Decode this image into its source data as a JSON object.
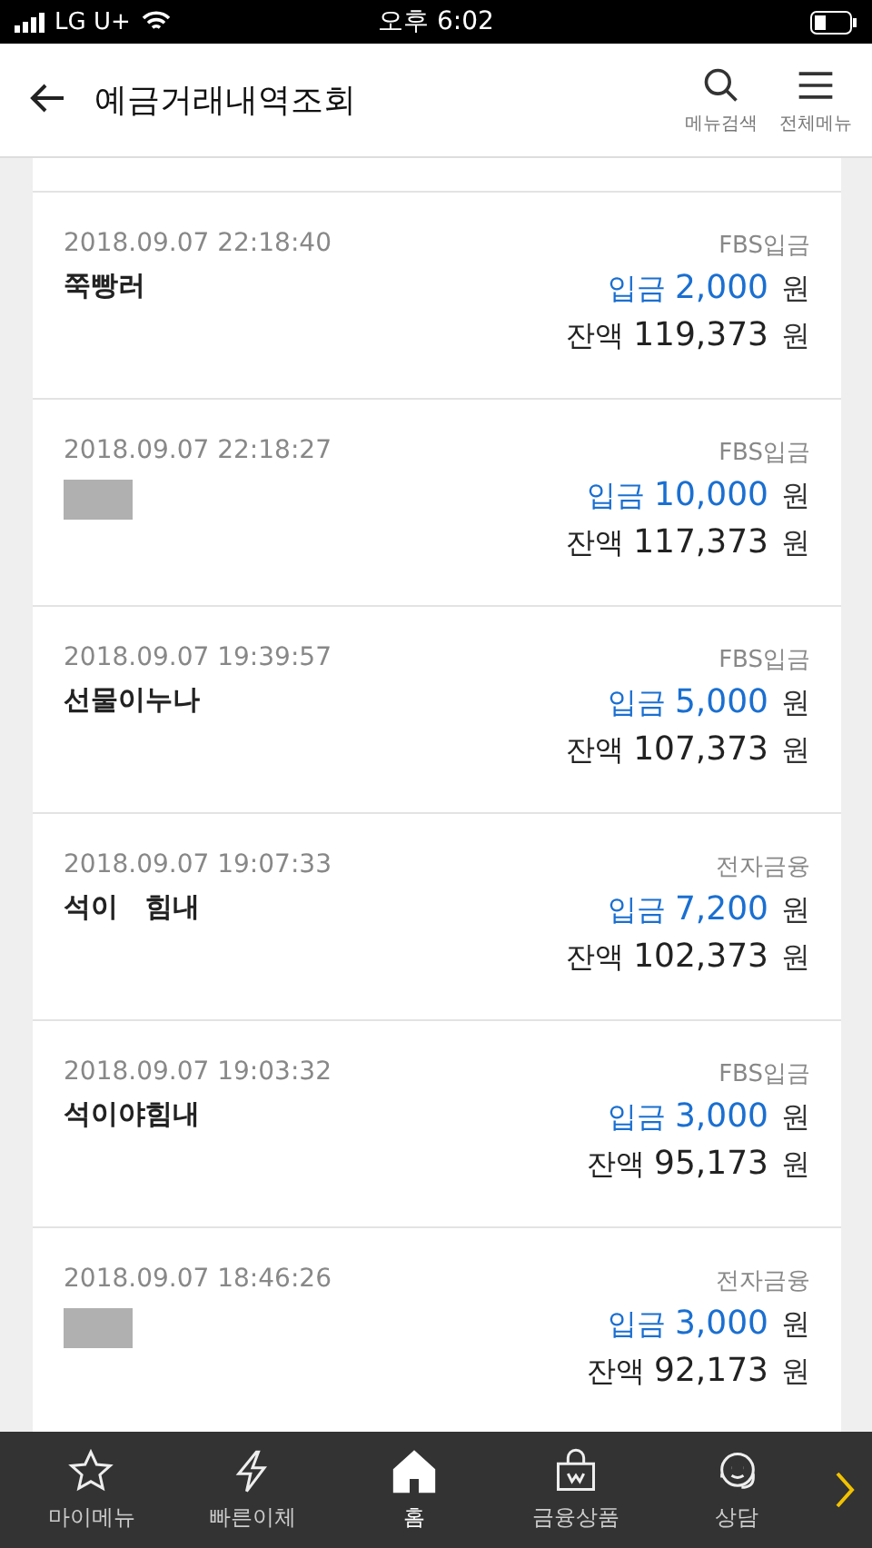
{
  "status_bar": {
    "carrier": "LG U+",
    "time": "오후 6:02"
  },
  "header": {
    "title": "예금거래내역조회",
    "actions": [
      {
        "kind": "search",
        "label": "메뉴검색"
      },
      {
        "kind": "menu",
        "label": "전체메뉴"
      }
    ]
  },
  "transactions": [
    {
      "datetime": "2018.09.07 22:18:40",
      "name": "쭉빵러",
      "redacted": false,
      "type": "FBS입금",
      "amount_label": "입금",
      "amount": "2,000",
      "amount_unit": "원",
      "balance_label": "잔액",
      "balance": "119,373",
      "balance_unit": "원"
    },
    {
      "datetime": "2018.09.07 22:18:27",
      "redacted": true,
      "type": "FBS입금",
      "amount_label": "입금",
      "amount": "10,000",
      "amount_unit": "원",
      "balance_label": "잔액",
      "balance": "117,373",
      "balance_unit": "원"
    },
    {
      "datetime": "2018.09.07 19:39:57",
      "name": "선물이누나",
      "redacted": false,
      "type": "FBS입금",
      "amount_label": "입금",
      "amount": "5,000",
      "amount_unit": "원",
      "balance_label": "잔액",
      "balance": "107,373",
      "balance_unit": "원"
    },
    {
      "datetime": "2018.09.07 19:07:33",
      "name": "석이　힘내",
      "redacted": false,
      "type": "전자금융",
      "amount_label": "입금",
      "amount": "7,200",
      "amount_unit": "원",
      "balance_label": "잔액",
      "balance": "102,373",
      "balance_unit": "원"
    },
    {
      "datetime": "2018.09.07 19:03:32",
      "name": "석이야힘내",
      "redacted": false,
      "type": "FBS입금",
      "amount_label": "입금",
      "amount": "3,000",
      "amount_unit": "원",
      "balance_label": "잔액",
      "balance": "95,173",
      "balance_unit": "원"
    },
    {
      "datetime": "2018.09.07 18:46:26",
      "redacted": true,
      "type": "전자금융",
      "amount_label": "입금",
      "amount": "3,000",
      "amount_unit": "원",
      "balance_label": "잔액",
      "balance": "92,173",
      "balance_unit": "원"
    }
  ],
  "bottom_nav": {
    "items": [
      {
        "kind": "star",
        "label": "마이메뉴",
        "selected": false
      },
      {
        "kind": "bolt",
        "label": "빠른이체",
        "selected": false
      },
      {
        "kind": "home",
        "label": "홈",
        "selected": true
      },
      {
        "kind": "bag",
        "label": "금융상품",
        "selected": false
      },
      {
        "kind": "agent",
        "label": "상담",
        "selected": false
      }
    ],
    "more": true
  }
}
